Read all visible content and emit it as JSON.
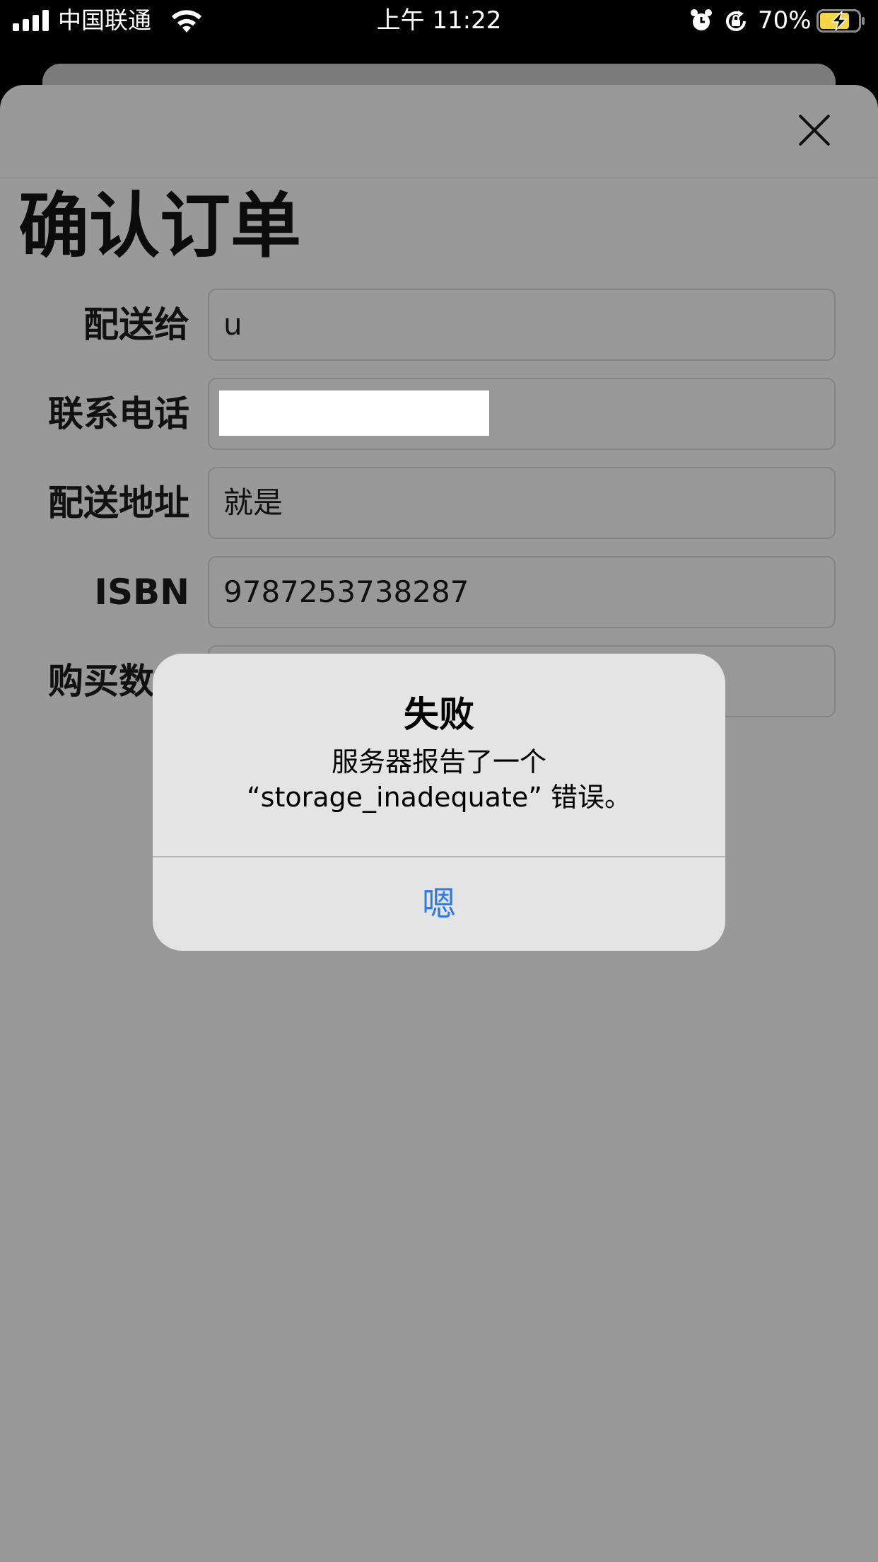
{
  "status_bar": {
    "carrier": "中国联通",
    "time": "上午 11:22",
    "battery_percent": "70%",
    "icons": [
      "signal-icon",
      "wifi-icon",
      "alarm-icon",
      "lock-rotation-icon",
      "battery-charging-icon"
    ]
  },
  "page": {
    "title": "确认订单",
    "close_icon": "close-icon"
  },
  "form": {
    "recipient": {
      "label": "配送给",
      "value": "u"
    },
    "phone": {
      "label": "联系电话",
      "value": ""
    },
    "address": {
      "label": "配送地址",
      "value": "就是"
    },
    "isbn": {
      "label": "ISBN",
      "value": "9787253738287"
    },
    "quantity": {
      "label": "购买数量",
      "value": ""
    }
  },
  "alert": {
    "title": "失败",
    "message_line1": "服务器报告了一个",
    "message_line2": "“storage_inadequate” 错误。",
    "button_label": "嗯"
  },
  "colors": {
    "accent": "#2f7ae5",
    "overlay": "#999999",
    "alert_bg": "#e4e4e4"
  }
}
